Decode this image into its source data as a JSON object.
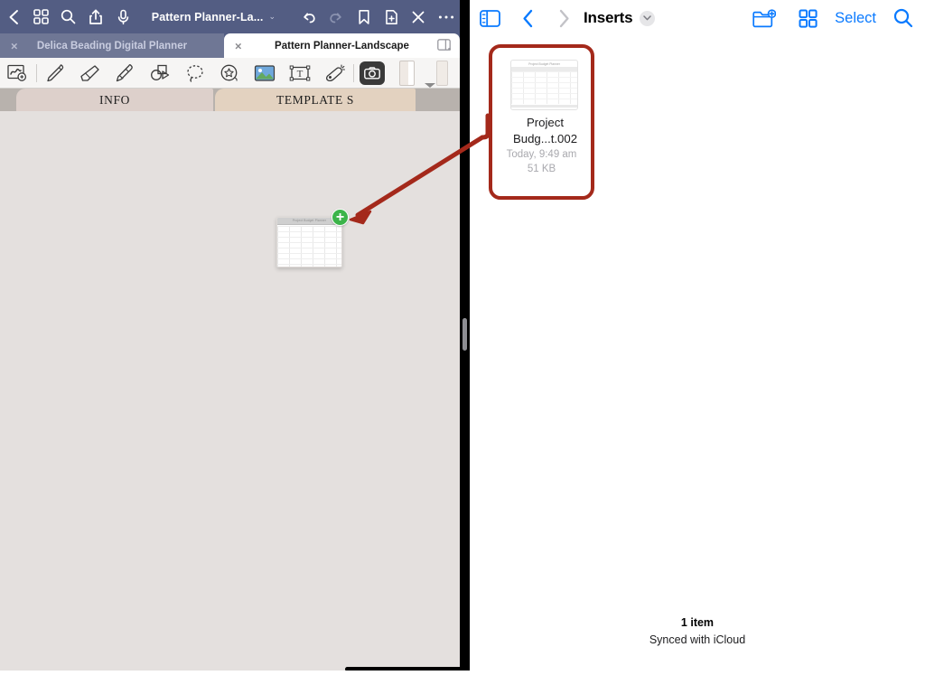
{
  "left_app": {
    "nav": {
      "back_icon": "chevron-left-icon",
      "grid_icon": "grid-view-icon",
      "search_icon": "search-icon",
      "share_icon": "share-icon",
      "mic_icon": "microphone-icon",
      "title": "Pattern Planner-La...",
      "title_chevron": "⌄",
      "undo_icon": "undo-icon",
      "redo_icon": "redo-icon",
      "bookmark_icon": "bookmark-icon",
      "add_page_icon": "add-page-icon",
      "close_icon": "close-icon",
      "more_icon": "more-options-icon"
    },
    "tabs": [
      {
        "label": "Delica Beading Digital Planner",
        "active": false,
        "close": "×"
      },
      {
        "label": "Pattern Planner-Landscape",
        "active": true,
        "close": "×"
      }
    ],
    "tools": [
      {
        "name": "zoom-tool",
        "label": "Zoom"
      },
      {
        "name": "pen-tool",
        "label": "Pen"
      },
      {
        "name": "eraser-tool",
        "label": "Eraser"
      },
      {
        "name": "highlighter-tool",
        "label": "Highlighter"
      },
      {
        "name": "shape-tool",
        "label": "Shape"
      },
      {
        "name": "lasso-tool",
        "label": "Lasso"
      },
      {
        "name": "sticker-tool",
        "label": "Sticker"
      },
      {
        "name": "image-tool",
        "label": "Image"
      },
      {
        "name": "text-tool",
        "label": "Text"
      },
      {
        "name": "laser-tool",
        "label": "Laser Pointer"
      },
      {
        "name": "camera-tool",
        "label": "Camera"
      }
    ],
    "page_tabs": [
      {
        "label": "INFO"
      },
      {
        "label": "TEMPLATE S"
      }
    ],
    "drag": {
      "thumb_title": "Project Budget Planner",
      "badge": "+"
    }
  },
  "right_app": {
    "nav": {
      "sidebar_icon": "sidebar-toggle-icon",
      "back_icon": "chevron-left-icon",
      "forward_icon": "chevron-right-icon",
      "title": "Inserts",
      "title_chevron": "⌄",
      "new_folder_icon": "new-folder-icon",
      "grid_icon": "grid-view-icon",
      "select_label": "Select",
      "search_icon": "search-icon"
    },
    "file": {
      "thumb_title": "Project Budget Planner",
      "name": "Project Budg...t.002",
      "date": "Today, 9:49 am",
      "size": "51 KB"
    },
    "status": {
      "count": "1 item",
      "sync": "Synced with iCloud"
    }
  },
  "colors": {
    "nav_navy": "#535d83",
    "canvas": "#e4e0de",
    "ios_blue": "#0a7aff",
    "annotation_red": "#a4291b",
    "badge_green": "#3cb44a",
    "tab_info": "#ddd0cb",
    "tab_templates": "#e3d2c0"
  }
}
